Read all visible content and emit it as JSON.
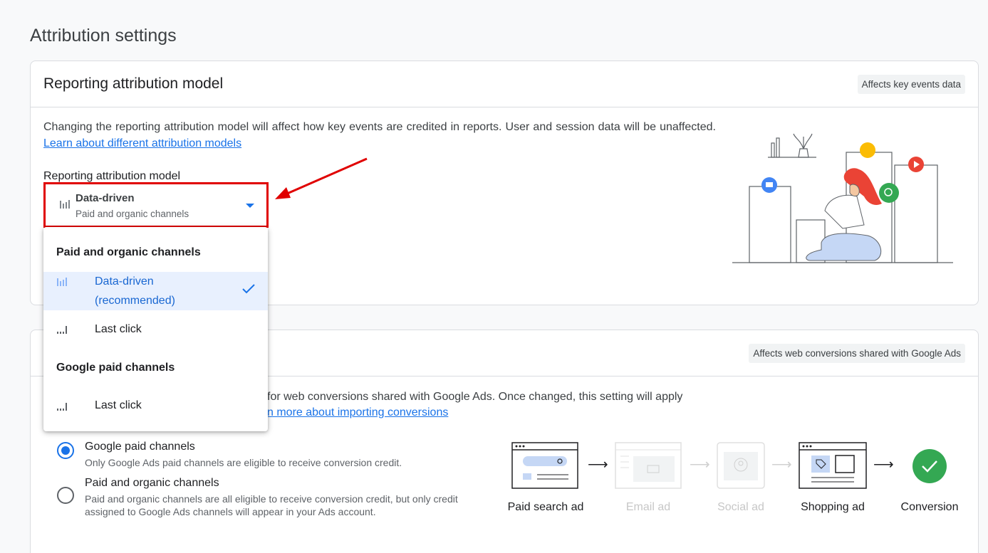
{
  "page_title": "Attribution settings",
  "reporting": {
    "card_title": "Reporting attribution model",
    "chip": "Affects key events data",
    "description": "Changing the reporting attribution model will affect how key events are credited in reports. User and session data will be unaffected.",
    "link": "Learn about different attribution models",
    "field_label": "Reporting attribution model",
    "selected_value": "Data-driven",
    "selected_sub": "Paid and organic channels"
  },
  "dropdown": {
    "group1": "Paid and organic channels",
    "item1_line1": "Data-driven",
    "item1_line2": "(recommended)",
    "item2": "Last click",
    "group2": "Google paid channels",
    "item3": "Last click"
  },
  "conversions": {
    "chip": "Affects web conversions shared with Google Ads",
    "description_line1": "for web conversions shared with Google Ads. Once changed, this setting will apply",
    "link_partial": "n more about importing conversions",
    "options": [
      {
        "title": "Google paid channels",
        "sub": "Only Google Ads paid channels are eligible to receive conversion credit.",
        "checked": true
      },
      {
        "title": "Paid and organic channels",
        "sub_line1": "Paid and organic channels are all eligible to receive conversion credit, but only credit",
        "sub_line2": "assigned to Google Ads channels will appear in your Ads account.",
        "checked": false
      }
    ],
    "flow": [
      "Paid search ad",
      "Email ad",
      "Social ad",
      "Shopping ad",
      "Conversion"
    ]
  },
  "colors": {
    "accent": "#1a73e8",
    "highlight": "#e00000",
    "success": "#34a853"
  }
}
